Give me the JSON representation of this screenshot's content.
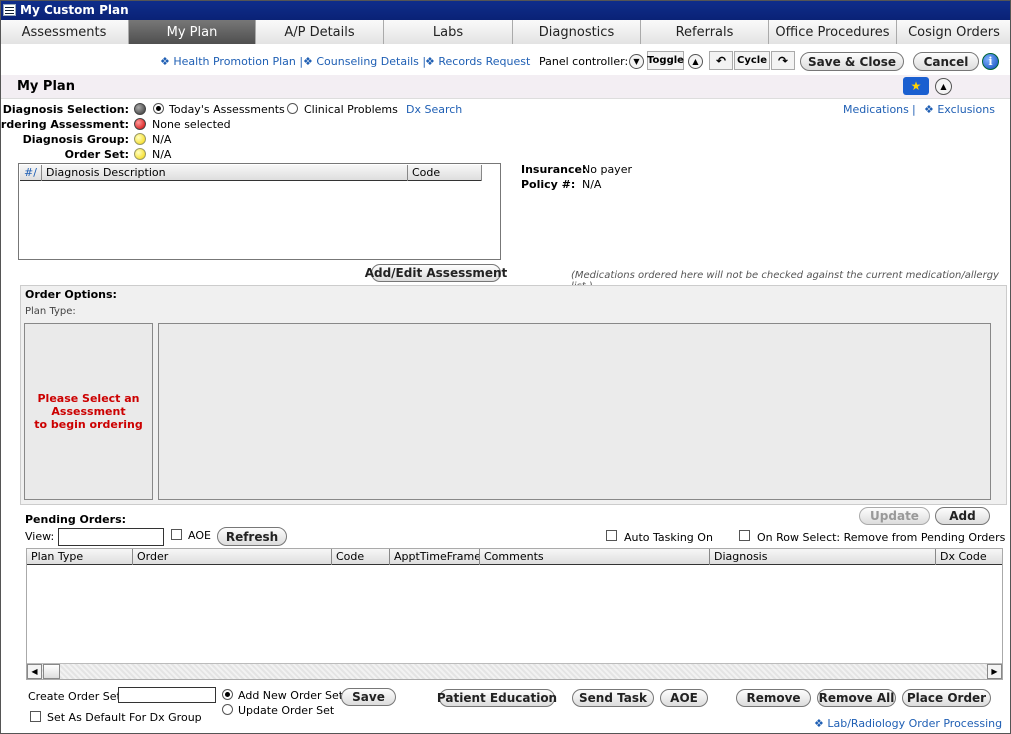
{
  "window": {
    "title": "My Custom Plan"
  },
  "tabs": [
    {
      "label": "Assessments"
    },
    {
      "label": "My Plan"
    },
    {
      "label": "A/P Details"
    },
    {
      "label": "Labs"
    },
    {
      "label": "Diagnostics"
    },
    {
      "label": "Referrals"
    },
    {
      "label": "Office Procedures"
    },
    {
      "label": "Cosign Orders"
    }
  ],
  "toolbar": {
    "links": [
      "❖ Health Promotion Plan |",
      "❖ Counseling Details |",
      "❖ Records Request"
    ],
    "panel_controller": "Panel controller:",
    "toggle": "Toggle",
    "cycle": "Cycle",
    "save_close": "Save & Close",
    "cancel": "Cancel"
  },
  "header": {
    "title": "My Plan"
  },
  "diagnosis": {
    "selection_label": "Diagnosis Selection:",
    "opt_today": "Today's Assessments",
    "opt_problems": "Clinical Problems",
    "dx_search": "Dx Search",
    "ordering_label": "Ordering Assessment:",
    "ordering_value": "None selected",
    "group_label": "Diagnosis Group:",
    "group_value": "N/A",
    "orderset_label": "Order Set:",
    "orderset_value": "N/A",
    "medications_link": "Medications",
    "sep": "|",
    "exclusions_link": "❖ Exclusions"
  },
  "dx_grid": {
    "columns": [
      "#/",
      "Diagnosis Description",
      "Code"
    ]
  },
  "insurance": {
    "ins_label": "Insurance:",
    "ins_value": "No payer",
    "policy_label": "Policy #:",
    "policy_value": "N/A"
  },
  "add_edit_assessment": "Add/Edit Assessment",
  "med_note": "(Medications ordered here will not be checked against the current medication/allergy list.)",
  "order_options": {
    "title": "Order Options:",
    "plan_type": "Plan Type:",
    "select_msg_1": "Please Select an",
    "select_msg_2": "Assessment",
    "select_msg_3": "to begin ordering"
  },
  "pending": {
    "title": "Pending Orders:",
    "view_label": "View:",
    "view_value": "",
    "aoe": "AOE",
    "refresh": "Refresh",
    "update": "Update",
    "add": "Add",
    "auto_tasking": "Auto Tasking On",
    "row_select": "On Row Select: Remove from Pending Orders",
    "columns": [
      "Plan Type",
      "Order",
      "Code",
      "ApptTimeFrame",
      "Comments",
      "Diagnosis",
      "Dx Code"
    ]
  },
  "footer": {
    "create_label": "Create Order Set:",
    "create_value": "",
    "add_new": "Add New Order Set",
    "update_set": "Update Order Set",
    "save": "Save",
    "default_dx": "Set As Default For Dx Group",
    "patient_education": "Patient Education",
    "send_task": "Send Task",
    "aoe": "AOE",
    "remove": "Remove",
    "remove_all": "Remove All",
    "place_order": "Place Order",
    "lab_link": "❖ Lab/Radiology Order Processing"
  },
  "colors": {
    "titlebar": "#0a2276",
    "link": "#1f5fb4",
    "warning": "#cc0000",
    "active_tab": "#5a5a5a"
  }
}
